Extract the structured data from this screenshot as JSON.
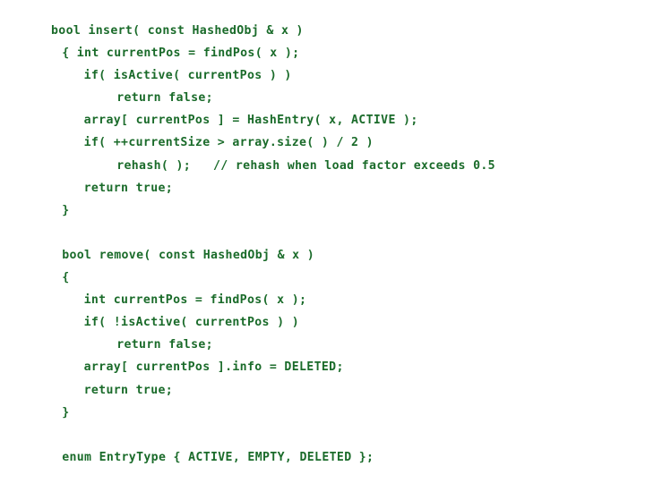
{
  "slide": {
    "background_color": "#ffffff",
    "text_color": "#1a6b2a",
    "language": "cpp"
  },
  "code": {
    "lines": [
      {
        "text": "bool insert( const HashedObj & x )",
        "indent": 0,
        "blank": false
      },
      {
        "text": "{ int currentPos = findPos( x );",
        "indent": 1,
        "blank": false
      },
      {
        "text": "if( isActive( currentPos ) )",
        "indent": 3,
        "blank": false
      },
      {
        "text": "return false;",
        "indent": 6,
        "blank": false
      },
      {
        "text": "array[ currentPos ] = HashEntry( x, ACTIVE );",
        "indent": 3,
        "blank": false
      },
      {
        "text": "if( ++currentSize > array.size( ) / 2 )",
        "indent": 3,
        "blank": false
      },
      {
        "text": "rehash( );   // rehash when load factor exceeds 0.5",
        "indent": 6,
        "blank": false
      },
      {
        "text": "return true;",
        "indent": 3,
        "blank": false
      },
      {
        "text": "}",
        "indent": 1,
        "blank": false
      },
      {
        "text": "",
        "indent": 0,
        "blank": true
      },
      {
        "text": "bool remove( const HashedObj & x )",
        "indent": 1,
        "blank": false
      },
      {
        "text": "{",
        "indent": 1,
        "blank": false
      },
      {
        "text": "int currentPos = findPos( x );",
        "indent": 3,
        "blank": false
      },
      {
        "text": "if( !isActive( currentPos ) )",
        "indent": 3,
        "blank": false
      },
      {
        "text": "return false;",
        "indent": 6,
        "blank": false
      },
      {
        "text": "array[ currentPos ].info = DELETED;",
        "indent": 3,
        "blank": false
      },
      {
        "text": "return true;",
        "indent": 3,
        "blank": false
      },
      {
        "text": "}",
        "indent": 1,
        "blank": false
      },
      {
        "text": "",
        "indent": 0,
        "blank": true
      },
      {
        "text": "enum EntryType { ACTIVE, EMPTY, DELETED };",
        "indent": 1,
        "blank": false
      }
    ]
  }
}
